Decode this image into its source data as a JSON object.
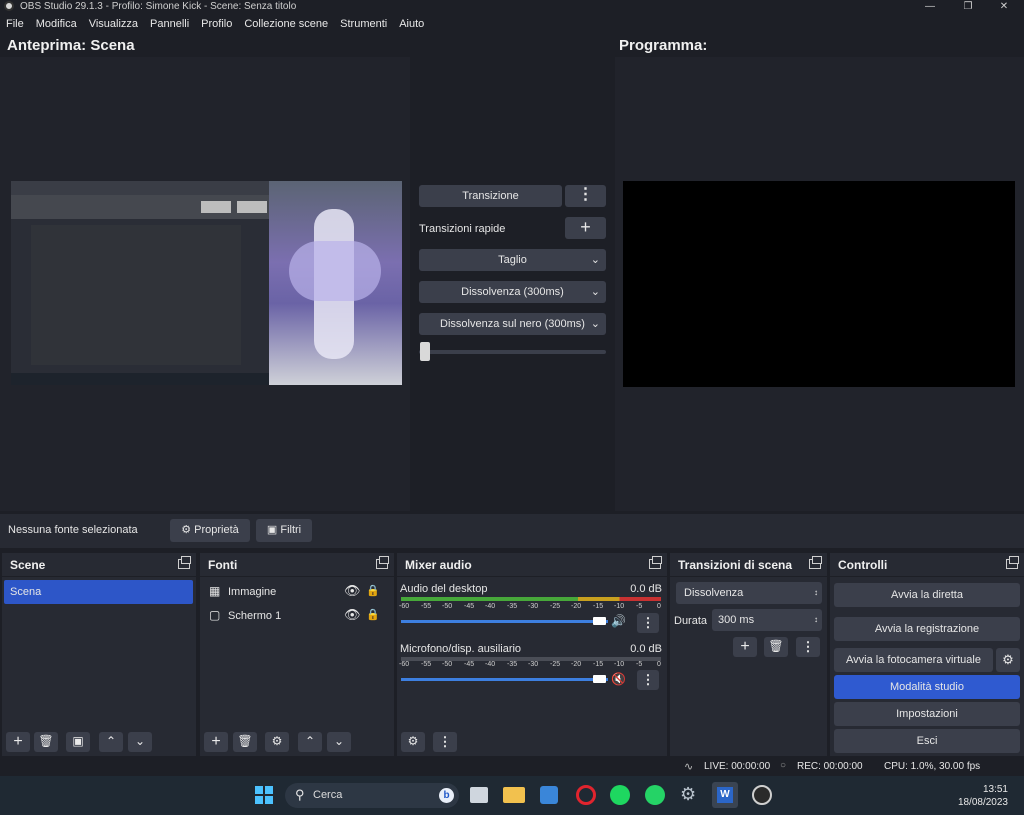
{
  "window": {
    "title": "OBS Studio 29.1.3 - Profilo: Simone Kick - Scene: Senza titolo"
  },
  "menu": [
    "File",
    "Modifica",
    "Visualizza",
    "Pannelli",
    "Profilo",
    "Collezione scene",
    "Strumenti",
    "Aiuto"
  ],
  "preview": {
    "heading": "Anteprima: Scena"
  },
  "program": {
    "heading": "Programma:"
  },
  "transition": {
    "button_label": "Transizione",
    "quick_label": "Transizioni rapide",
    "items": [
      "Taglio",
      "Dissolvenza (300ms)",
      "Dissolvenza sul nero (300ms)"
    ]
  },
  "source_bar": {
    "status": "Nessuna fonte selezionata",
    "properties": "Proprietà",
    "filters": "Filtri"
  },
  "scenes": {
    "title": "Scene",
    "items": [
      "Scena"
    ]
  },
  "sources": {
    "title": "Fonti",
    "items": [
      "Immagine",
      "Schermo 1"
    ]
  },
  "mixer": {
    "title": "Mixer audio",
    "ticks": [
      "-60",
      "-55",
      "-50",
      "-45",
      "-40",
      "-35",
      "-30",
      "-25",
      "-20",
      "-15",
      "-10",
      "-5",
      "0"
    ],
    "channels": [
      {
        "name": "Audio del desktop",
        "db": "0.0 dB",
        "volume": 1.0,
        "muted": false
      },
      {
        "name": "Microfono/disp. ausiliario",
        "db": "0.0 dB",
        "volume": 1.0,
        "muted": true
      }
    ]
  },
  "scene_transitions": {
    "title": "Transizioni di scena",
    "selected": "Dissolvenza",
    "duration_label": "Durata",
    "duration_value": "300 ms"
  },
  "controls": {
    "title": "Controlli",
    "start_stream": "Avvia la diretta",
    "start_record": "Avvia la registrazione",
    "virtual_cam": "Avvia la fotocamera virtuale",
    "studio_mode": "Modalità studio",
    "settings": "Impostazioni",
    "exit": "Esci"
  },
  "status": {
    "live": "LIVE: 00:00:00",
    "rec": "REC: 00:00:00",
    "cpu": "CPU: 1.0%, 30.00 fps"
  },
  "taskbar": {
    "search_placeholder": "Cerca",
    "time": "13:51",
    "date": "18/08/2023"
  },
  "colors": {
    "accent": "#2f5ad0",
    "selected_scene": "#2d56c8",
    "meter_green": "#47a83a",
    "meter_yellow": "#c8a01f",
    "meter_red": "#c83232",
    "slider_blue": "#3d7fe0",
    "muted_red": "#e03030"
  }
}
